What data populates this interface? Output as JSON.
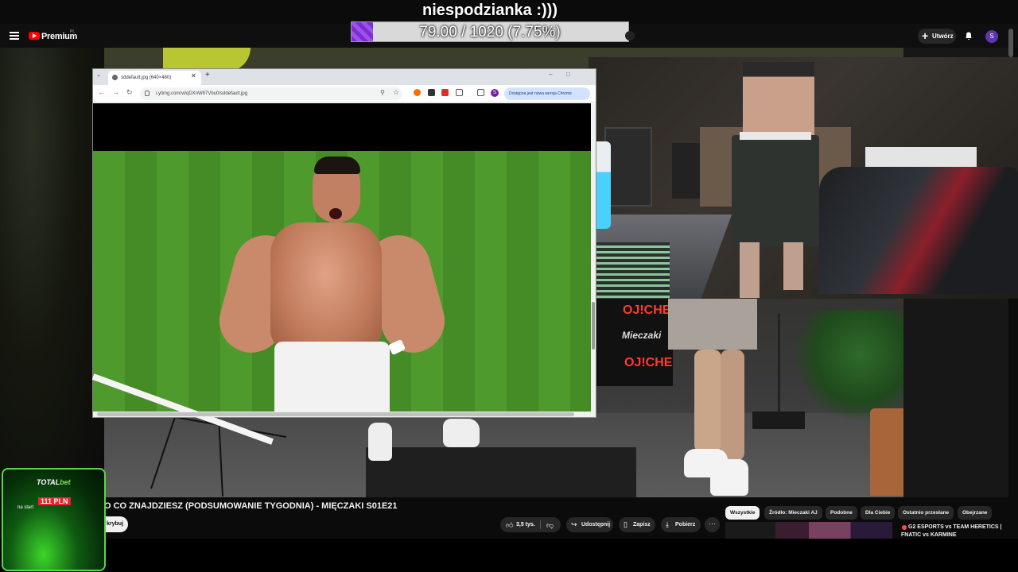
{
  "overlay": {
    "goal_title": "niespodzianka :)))",
    "goal_text": "79.00 / 1020 (7.75%)",
    "goal_progress": 0.0775
  },
  "header": {
    "brand": "Premium",
    "region": "PL",
    "create_label": "Utwórz",
    "avatar_letter": "S"
  },
  "browser": {
    "tab_title": "sddefault.jpg (640×480)",
    "url": "i.ytimg.com/vi/qDXnW87Vbu0/sddefault.jpg",
    "update_notice": "Dostępna jest nowa wersja Chrome",
    "profile_letter": "S"
  },
  "webcam_scene": {
    "banner_1": "OJ!CHE",
    "banner_2": "Mieczaki",
    "banner_3": "OJ!CHE"
  },
  "promo": {
    "brand_1": "TOTAL",
    "brand_2": "bet",
    "amount": "111 PLN",
    "subtitle": "na start"
  },
  "video": {
    "title": "O CO ZNAJDZIESZ (PODSUMOWANIE TYGODNIA) - MIĘCZAKI S01E21",
    "subscribe_label": "krybuj",
    "like_count": "3,5 tys.",
    "share_label": "Udostępnij",
    "save_label": "Zapisz",
    "download_label": "Pobierz"
  },
  "chips": [
    {
      "label": "Wszystkie",
      "active": true
    },
    {
      "label": "Źródło: Mieczaki AJ",
      "active": false
    },
    {
      "label": "Podobne",
      "active": false
    },
    {
      "label": "Dla Ciebie",
      "active": false
    },
    {
      "label": "Ostatnio przesłane",
      "active": false
    },
    {
      "label": "Obejrzane",
      "active": false
    }
  ],
  "recommended": {
    "title": "G2 ESPORTS vs TEAM HERETICS | FNATIC vs KARMINE"
  },
  "colors": {
    "accent_red": "#ff0000",
    "goal_purple": "#8a3ae0",
    "promo_green": "#3cd62a"
  }
}
